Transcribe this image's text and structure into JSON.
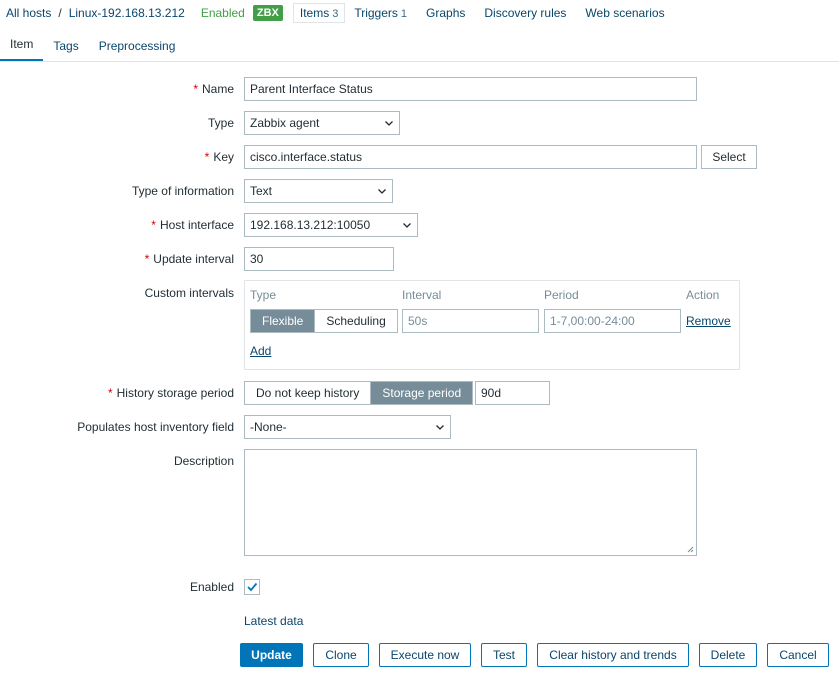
{
  "breadcrumb": {
    "all_hosts": "All hosts",
    "separator": "/",
    "host": "Linux-192.168.13.212",
    "status": "Enabled",
    "badge": "ZBX"
  },
  "nav": {
    "items_label": "Items",
    "items_count": "3",
    "triggers_label": "Triggers",
    "triggers_count": "1",
    "graphs": "Graphs",
    "discovery_rules": "Discovery rules",
    "web_scenarios": "Web scenarios"
  },
  "tabs": [
    "Item",
    "Tags",
    "Preprocessing"
  ],
  "form": {
    "name_label": "Name",
    "name_value": "Parent Interface Status",
    "type_label": "Type",
    "type_value": "Zabbix agent",
    "key_label": "Key",
    "key_value": "cisco.interface.status",
    "key_select": "Select",
    "info_label": "Type of information",
    "info_value": "Text",
    "host_if_label": "Host interface",
    "host_if_value": "192.168.13.212:10050",
    "update_label": "Update interval",
    "update_value": "30",
    "custom_label": "Custom intervals",
    "custom": {
      "col_type": "Type",
      "col_interval": "Interval",
      "col_period": "Period",
      "col_action": "Action",
      "flexible": "Flexible",
      "scheduling": "Scheduling",
      "interval_placeholder": "50s",
      "period_placeholder": "1-7,00:00-24:00",
      "remove": "Remove",
      "add": "Add"
    },
    "history_label": "History storage period",
    "history_no_keep": "Do not keep history",
    "history_storage": "Storage period",
    "history_value": "90d",
    "inventory_label": "Populates host inventory field",
    "inventory_value": "-None-",
    "description_label": "Description",
    "enabled_label": "Enabled",
    "latest_data": "Latest data"
  },
  "buttons": {
    "update": "Update",
    "clone": "Clone",
    "execute_now": "Execute now",
    "test": "Test",
    "clear_history": "Clear history and trends",
    "delete": "Delete",
    "cancel": "Cancel"
  },
  "colors": {
    "link": "#0a466a",
    "primary": "#0275b8",
    "enabled": "#429e47",
    "required": "#d40000"
  }
}
